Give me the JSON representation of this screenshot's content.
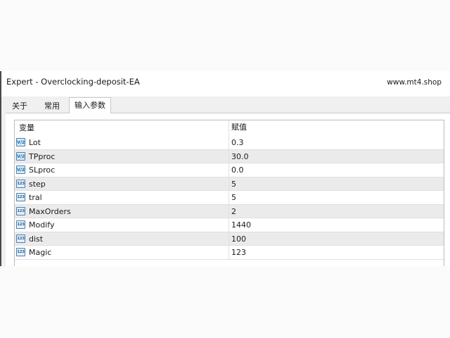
{
  "window": {
    "title": "Expert - Overclocking-deposit-EA",
    "watermark": "www.mt4.shop"
  },
  "tabs": [
    {
      "label": "关于",
      "active": false
    },
    {
      "label": "常用",
      "active": false
    },
    {
      "label": "输入参数",
      "active": true
    }
  ],
  "table": {
    "headers": {
      "variable": "变量",
      "value": "赋值"
    },
    "rows": [
      {
        "icon": "double-type-icon",
        "icon_text": "V/2",
        "name": "Lot",
        "value": "0.3"
      },
      {
        "icon": "double-type-icon",
        "icon_text": "V/2",
        "name": "TPproc",
        "value": "30.0"
      },
      {
        "icon": "double-type-icon",
        "icon_text": "V/2",
        "name": "SLproc",
        "value": "0.0"
      },
      {
        "icon": "integer-type-icon",
        "icon_text": "123",
        "name": "step",
        "value": "5"
      },
      {
        "icon": "integer-type-icon",
        "icon_text": "123",
        "name": "tral",
        "value": "5"
      },
      {
        "icon": "integer-type-icon",
        "icon_text": "123",
        "name": "MaxOrders",
        "value": "2"
      },
      {
        "icon": "integer-type-icon",
        "icon_text": "123",
        "name": "Modify",
        "value": "1440"
      },
      {
        "icon": "integer-type-icon",
        "icon_text": "123",
        "name": "dist",
        "value": "100"
      },
      {
        "icon": "integer-type-icon",
        "icon_text": "123",
        "name": "Magic",
        "value": "123"
      }
    ]
  }
}
